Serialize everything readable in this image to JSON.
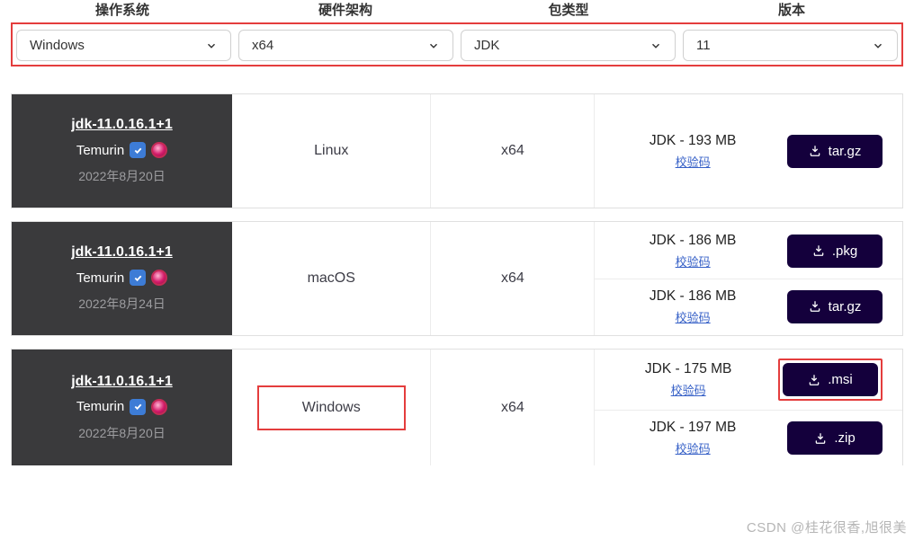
{
  "filter_labels": {
    "os": "操作系统",
    "arch": "硬件架构",
    "pkg": "包类型",
    "ver": "版本"
  },
  "filters": {
    "os": "Windows",
    "arch": "x64",
    "pkg": "JDK",
    "ver": "11"
  },
  "checksum_label": "校验码",
  "rows": [
    {
      "version": "jdk-11.0.16.1+1",
      "vendor": "Temurin",
      "date": "2022年8月20日",
      "os": "Linux",
      "arch": "x64",
      "downloads": [
        {
          "size": "JDK - 193 MB",
          "ext": "tar.gz"
        }
      ]
    },
    {
      "version": "jdk-11.0.16.1+1",
      "vendor": "Temurin",
      "date": "2022年8月24日",
      "os": "macOS",
      "arch": "x64",
      "downloads": [
        {
          "size": "JDK - 186 MB",
          "ext": ".pkg"
        },
        {
          "size": "JDK - 186 MB",
          "ext": "tar.gz"
        }
      ]
    },
    {
      "version": "jdk-11.0.16.1+1",
      "vendor": "Temurin",
      "date": "2022年8月20日",
      "os": "Windows",
      "arch": "x64",
      "downloads": [
        {
          "size": "JDK - 175 MB",
          "ext": ".msi"
        },
        {
          "size": "JDK - 197 MB",
          "ext": ".zip"
        }
      ]
    }
  ],
  "watermark": "CSDN @桂花很香,旭很美"
}
